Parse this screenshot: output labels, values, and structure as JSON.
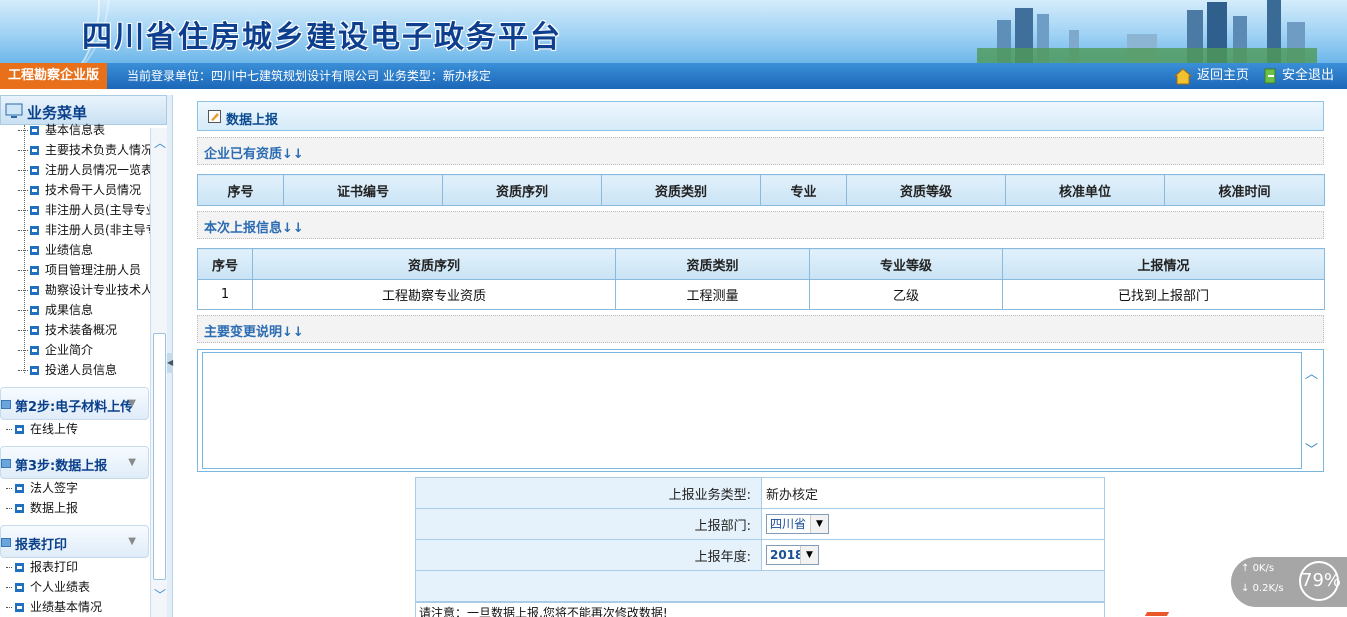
{
  "header": {
    "site_title": "四川省住房城乡建设电子政务平台"
  },
  "statusbar": {
    "edition": "工程勘察企业版",
    "login_info": "当前登录单位：四川中七建筑规划设计有限公司   业务类型：新办核定",
    "home_label": "返回主页",
    "logout_label": "安全退出"
  },
  "sidebar": {
    "menu_title": "业务菜单",
    "items": [
      {
        "label": "基本信息表"
      },
      {
        "label": "主要技术负责人情况"
      },
      {
        "label": "注册人员情况一览表"
      },
      {
        "label": "技术骨干人员情况"
      },
      {
        "label": "非注册人员(主导专业"
      },
      {
        "label": "非注册人员(非主导专"
      },
      {
        "label": "业绩信息"
      },
      {
        "label": "项目管理注册人员"
      },
      {
        "label": "勘察设计专业技术人"
      },
      {
        "label": "成果信息"
      },
      {
        "label": "技术装备概况"
      },
      {
        "label": "企业简介"
      },
      {
        "label": "投递人员信息"
      }
    ],
    "steps": [
      {
        "label": "第2步:电子材料上传",
        "items": [
          {
            "label": "在线上传"
          }
        ]
      },
      {
        "label": "第3步:数据上报",
        "items": [
          {
            "label": "法人签字"
          },
          {
            "label": "数据上报"
          }
        ]
      },
      {
        "label": "报表打印",
        "items": [
          {
            "label": "报表打印"
          },
          {
            "label": "个人业绩表"
          },
          {
            "label": "业绩基本情况"
          }
        ]
      }
    ]
  },
  "main": {
    "panel_title": "数据上报",
    "sections": {
      "existing": "企业已有资质↓↓",
      "current": "本次上报信息↓↓",
      "changes": "主要变更说明↓↓"
    },
    "existing_table": {
      "headers": [
        "序号",
        "证书编号",
        "资质序列",
        "资质类别",
        "专业",
        "资质等级",
        "核准单位",
        "核准时间"
      ]
    },
    "current_table": {
      "headers": [
        "序号",
        "资质序列",
        "资质类别",
        "专业等级",
        "上报情况"
      ],
      "rows": [
        [
          "1",
          "工程勘察专业资质",
          "工程测量",
          "乙级",
          "已找到上报部门"
        ]
      ]
    },
    "change_text": "",
    "form": {
      "type_label": "上报业务类型:",
      "type_value": "新办核定",
      "dept_label": "上报部门:",
      "dept_value": "四川省",
      "year_label": "上报年度:",
      "year_value": "2018"
    },
    "note": "请注意：一旦数据上报,您将不能再次修改数据!"
  },
  "speed_widget": {
    "upload": "0K/s",
    "download": "0.2K/s",
    "percent": "79%"
  },
  "colors": {
    "accent": "#1b67b8",
    "edition_bg": "#e8701a",
    "title_blue": "#0d3f8e"
  }
}
